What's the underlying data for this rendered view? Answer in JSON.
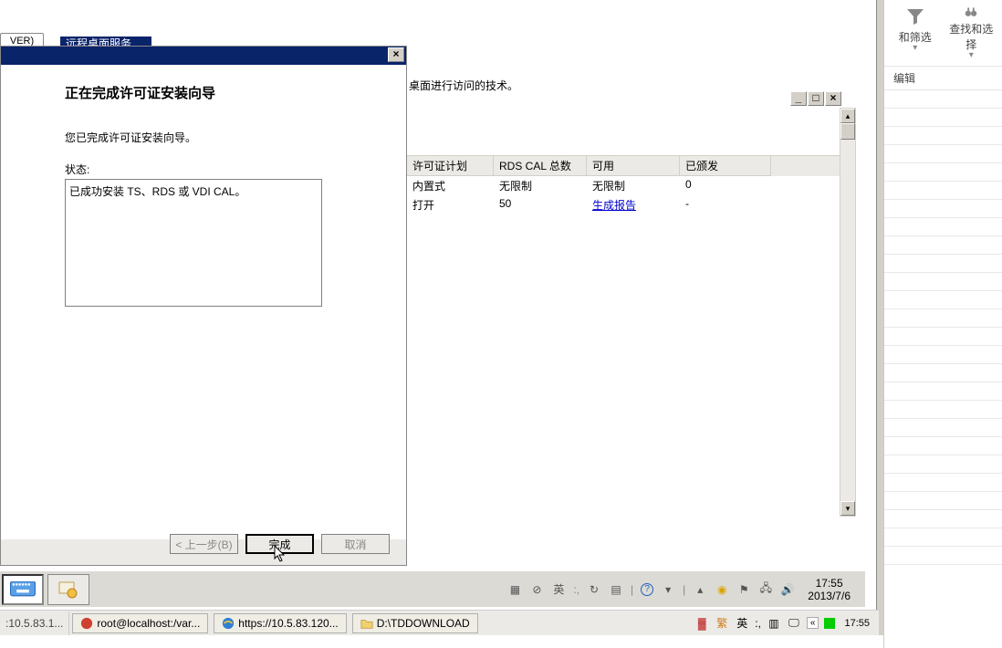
{
  "top": {
    "ver": "VER)",
    "rds_tab": "远程桌面服务"
  },
  "wizard": {
    "title": "正在完成许可证安装向导",
    "msg": "您已完成许可证安装向导。",
    "state_label": "状态:",
    "state_text": "已成功安装 TS、RDS 或 VDI CAL。",
    "btn_back": "< 上一步(B)",
    "btn_finish": "完成",
    "btn_cancel": "取消"
  },
  "licmgr": {
    "desc_fragment": "桌面进行访问的技术。",
    "headers": {
      "c1": "许可证计划",
      "c2": "RDS CAL 总数",
      "c3": "可用",
      "c4": "已颁发"
    },
    "rows": [
      {
        "c1": "内置式",
        "c2": "无限制",
        "c3": "无限制",
        "c4": "0"
      },
      {
        "c1": "打开",
        "c2": "50",
        "c3": "生成报告",
        "c4": "-"
      }
    ]
  },
  "inner_tray": {
    "lang": "英",
    "time": "17:55",
    "date": "2013/7/6"
  },
  "host": {
    "addr": ":10.5.83.1...",
    "t1": "root@localhost:/var...",
    "t2": "https://10.5.83.120...",
    "t3": "D:\\TDDOWNLOAD",
    "lang": "英",
    "time": "17:55",
    "expander": "«"
  },
  "right": {
    "label1": "和筛选",
    "label2": "查找和选择",
    "edit": "编辑"
  }
}
